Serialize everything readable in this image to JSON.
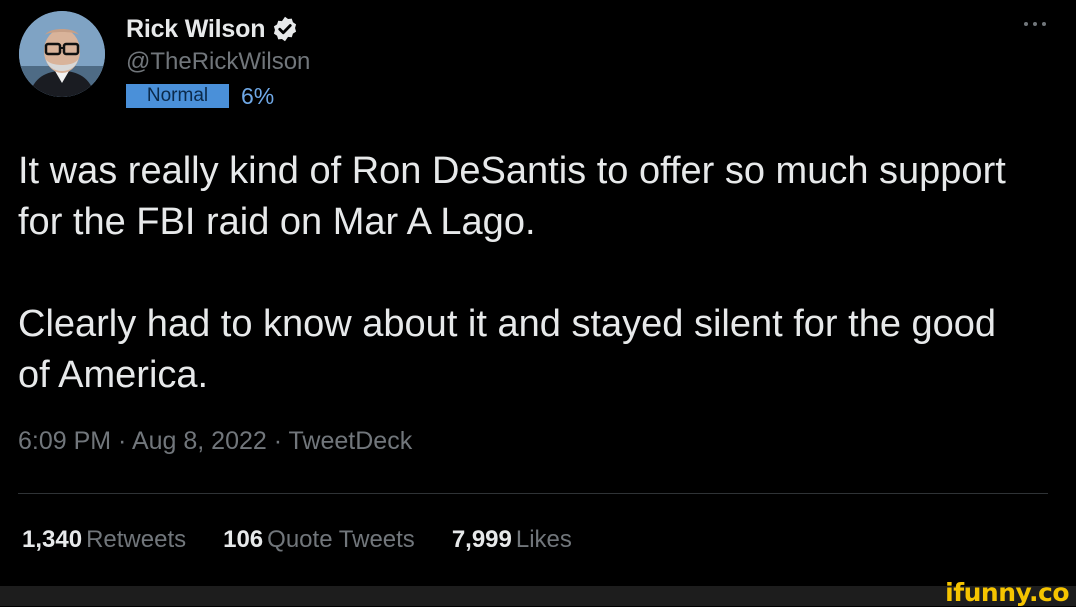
{
  "author": {
    "name": "Rick Wilson",
    "handle": "@TheRickWilson",
    "badge_label": "Normal",
    "badge_percent": "6%"
  },
  "tweet": {
    "paragraph1": "It was really kind of Ron DeSantis to offer so much support for the FBI raid on Mar A Lago.",
    "paragraph2": "Clearly had to know about it and stayed silent for the good of America.",
    "meta": "6:09 PM · Aug 8, 2022 · TweetDeck"
  },
  "stats": [
    {
      "value": "1,340",
      "label": "Retweets"
    },
    {
      "value": "106",
      "label": "Quote Tweets"
    },
    {
      "value": "7,999",
      "label": "Likes"
    }
  ],
  "watermark": "ifunny.co",
  "colors": {
    "background": "#000000",
    "text": "#e7e9ea",
    "secondary": "#71767b",
    "verified": "#1d9bf0",
    "badge": "#4a90d9",
    "watermark": "#f5c400"
  },
  "icons": {
    "verified": "verified-badge-icon",
    "more": "more-options-icon"
  }
}
